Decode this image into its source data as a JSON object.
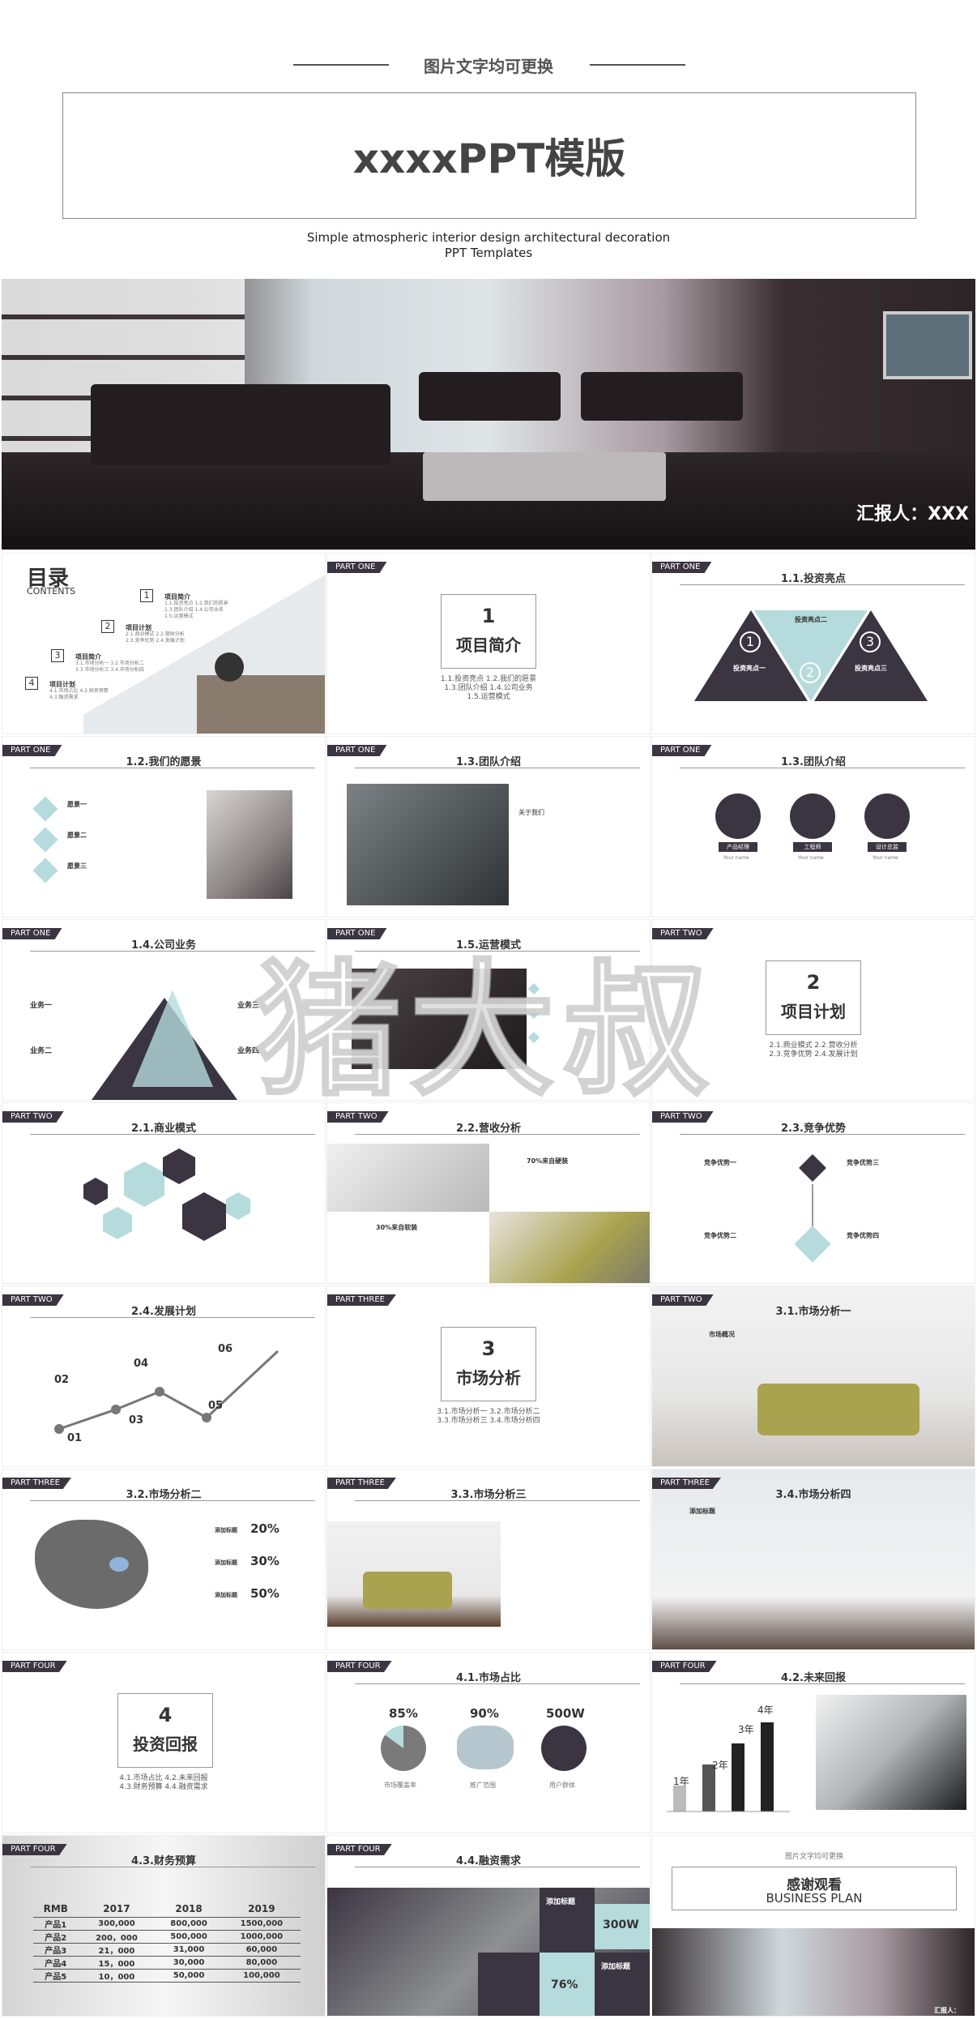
{
  "hero": {
    "subtitle": "图片文字均可更换",
    "title": "xxxxPPT模版",
    "eng_line1": "Simple atmospheric interior design architectural decoration",
    "eng_line2": "PPT Templates",
    "reporter": "汇报人：XXX"
  },
  "toc": {
    "title": "目录",
    "sub": "CONTENTS",
    "items": [
      {
        "num": "1",
        "label": "项目简介",
        "sub": "1.1.投资亮点 1.2.我们的愿景\n1.3.团队介绍 1.4.公司业务\n1.5.运营模式"
      },
      {
        "num": "2",
        "label": "项目计划",
        "sub": "2.1.商业模式 2.2.营收分析\n2.3.竞争优势 2.4.发展计划"
      },
      {
        "num": "3",
        "label": "项目简介",
        "sub": "3.1.市场分析一 3.2.市场分析二\n3.3.市场分析三 3.4.市场分析四"
      },
      {
        "num": "4",
        "label": "项目计划",
        "sub": "4.1.市场占比 4.2.财务预算\n4.3.融资需求"
      }
    ]
  },
  "slides": {
    "p1": {
      "tag": "PART ONE",
      "num": "1",
      "title": "项目简介",
      "sub": "1.1.投资亮点 1.2.我们的愿景\n1.3.团队介绍 1.4.公司业务\n1.5.运营模式"
    },
    "s11": {
      "tag": "PART ONE",
      "title": "1.1.投资亮点",
      "a": "投资亮点一",
      "b": "投资亮点二",
      "c": "投资亮点三",
      "n1": "1",
      "n2": "2",
      "n3": "3"
    },
    "s12": {
      "tag": "PART ONE",
      "title": "1.2.我们的愿景",
      "i1": "愿景一",
      "i2": "愿景二",
      "i3": "愿景三"
    },
    "s13a": {
      "tag": "PART ONE",
      "title": "1.3.团队介绍",
      "about": "关于我们"
    },
    "s13b": {
      "tag": "PART ONE",
      "title": "1.3.团队介绍",
      "r1": "产品经理",
      "r2": "工程师",
      "r3": "设计总监",
      "name": "Your name"
    },
    "s14": {
      "tag": "PART ONE",
      "title": "1.4.公司业务",
      "b1": "业务一",
      "b2": "业务二",
      "b3": "业务三",
      "b4": "业务四"
    },
    "s15": {
      "tag": "PART ONE",
      "title": "1.5.运营模式"
    },
    "p2": {
      "tag": "PART TWO",
      "num": "2",
      "title": "项目计划",
      "sub": "2.1.商业模式 2.2.营收分析\n2.3.竞争优势 2.4.发展计划"
    },
    "s21": {
      "tag": "PART TWO",
      "title": "2.1.商业模式"
    },
    "s22": {
      "tag": "PART TWO",
      "title": "2.2.营收分析",
      "a": "70%来自硬装",
      "b": "30%来自软装"
    },
    "s23": {
      "tag": "PART TWO",
      "title": "2.3.竞争优势",
      "a": "竞争优势一",
      "b": "竞争优势二",
      "c": "竞争优势三",
      "d": "竞争优势四"
    },
    "s24": {
      "tag": "PART TWO",
      "title": "2.4.发展计划",
      "n1": "01",
      "n2": "02",
      "n3": "03",
      "n4": "04",
      "n5": "05",
      "n6": "06"
    },
    "p3": {
      "tag": "PART THREE",
      "num": "3",
      "title": "市场分析",
      "sub": "3.1.市场分析一 3.2.市场分析二\n3.3.市场分析三 3.4.市场分析四"
    },
    "s31": {
      "tag": "PART TWO",
      "title": "3.1.市场分析一",
      "h": "市场概况"
    },
    "s32": {
      "tag": "PART THREE",
      "title": "3.2.市场分析二",
      "l": "添加标题",
      "v1": "20%",
      "v2": "30%",
      "v3": "50%"
    },
    "s33": {
      "tag": "PART THREE",
      "title": "3.3.市场分析三"
    },
    "s34": {
      "tag": "PART THREE",
      "title": "3.4.市场分析四",
      "h": "添加标题"
    },
    "p4": {
      "tag": "PART FOUR",
      "num": "4",
      "title": "投资回报",
      "sub": "4.1.市场占比 4.2.未来回报\n4.3.财务预算 4.4.融资需求"
    },
    "s41": {
      "tag": "PART FOUR",
      "title": "4.1.市场占比",
      "v1": "85%",
      "v2": "90%",
      "v3": "500W",
      "l1": "市场覆盖率",
      "l2": "推广范围",
      "l3": "用户群体"
    },
    "s42": {
      "tag": "PART FOUR",
      "title": "4.2.未来回报",
      "y1": "1年",
      "y2": "2年",
      "y3": "3年",
      "y4": "4年"
    },
    "s43": {
      "tag": "PART FOUR",
      "title": "4.3.财务预算"
    },
    "s44": {
      "tag": "PART FOUR",
      "title": "4.4.融资需求",
      "a": "添加标题",
      "b": "添加标题",
      "v1": "300W",
      "v2": "76%"
    },
    "end": {
      "sub": "图片文字均可更换",
      "title": "感谢观看",
      "eng": "BUSINESS PLAN",
      "reporter": "汇报人：XXX"
    }
  },
  "budget_table": {
    "headers": [
      "RMB",
      "2017",
      "2018",
      "2019"
    ],
    "rows": [
      [
        "产品1",
        "300,000",
        "800,000",
        "1500,000"
      ],
      [
        "产品2",
        "200，000",
        "500,000",
        "1000,000"
      ],
      [
        "产品3",
        "21，000",
        "31,000",
        "60,000"
      ],
      [
        "产品4",
        "15，000",
        "30,000",
        "80,000"
      ],
      [
        "产品5",
        "10，000",
        "50,000",
        "100,000"
      ]
    ]
  },
  "bar_chart": {
    "type": "bar",
    "categories": [
      "1年",
      "2年",
      "3年",
      "4年"
    ],
    "values": [
      1,
      2,
      3,
      4
    ]
  },
  "watermark": "猪大叔",
  "colors": {
    "dark": "#3b3541",
    "mint": "#b5dbdc",
    "gray": "#888888"
  }
}
